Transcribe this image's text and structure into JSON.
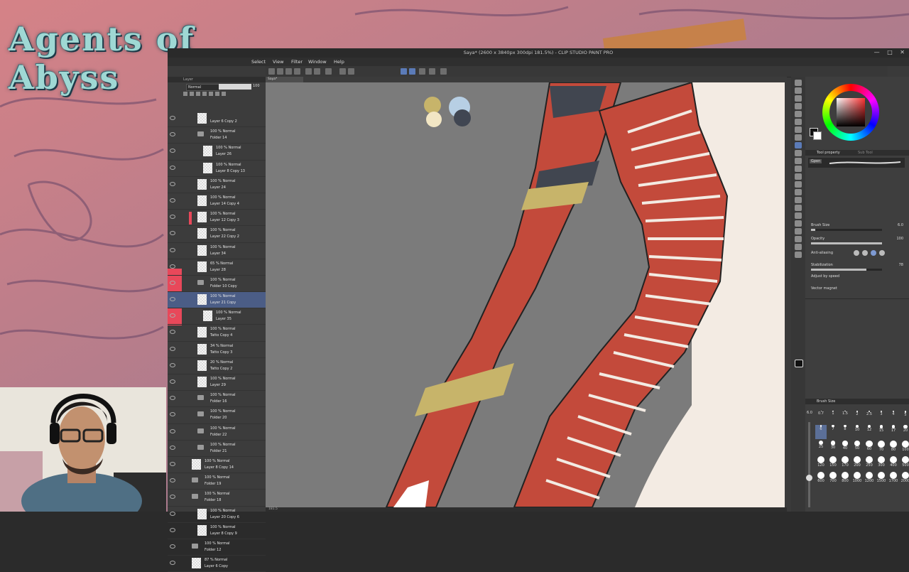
{
  "overlay": {
    "logo_text": "Agents of Abyss"
  },
  "window": {
    "title": "Saya* (2600 x 3840px 300dpi 181.5%) - CLIP STUDIO PAINT PRO",
    "controls": [
      "—",
      "□",
      "✕"
    ]
  },
  "menu": [
    "Select",
    "View",
    "Filter",
    "Window",
    "Help"
  ],
  "layer_panel": {
    "tab": "Layer",
    "blend_mode": "Normal",
    "opacity": "100",
    "layers": [
      {
        "top": "",
        "bottom": "Layer 6 Copy 2",
        "type": "layer",
        "indent": 1
      },
      {
        "top": "100 % Normal",
        "bottom": "Folder 14",
        "type": "folder",
        "indent": 1
      },
      {
        "top": "100 % Normal",
        "bottom": "Layer 26",
        "type": "layer",
        "indent": 2
      },
      {
        "top": "100 % Normal",
        "bottom": "Layer 8 Copy 13",
        "type": "layer",
        "indent": 2
      },
      {
        "top": "100 % Normal",
        "bottom": "Layer 24",
        "type": "layer",
        "indent": 1
      },
      {
        "top": "100 % Normal",
        "bottom": "Layer 14 Copy 4",
        "type": "layer",
        "indent": 1
      },
      {
        "top": "100 % Normal",
        "bottom": "Layer 12 Copy 3",
        "type": "layer",
        "indent": 1
      },
      {
        "top": "100 % Normal",
        "bottom": "Layer 22 Copy 2",
        "type": "layer",
        "indent": 1
      },
      {
        "top": "100 % Normal",
        "bottom": "Layer 34",
        "type": "layer",
        "indent": 1
      },
      {
        "top": "65 % Normal",
        "bottom": "Layer 28",
        "type": "layer",
        "indent": 1
      },
      {
        "top": "100 % Normal",
        "bottom": "Folder 10 Copy",
        "type": "folder",
        "indent": 1
      },
      {
        "top": "100 % Normal",
        "bottom": "Layer 21 Copy",
        "type": "layer",
        "indent": 1,
        "selected": true
      },
      {
        "top": "100 % Normal",
        "bottom": "Layer 35",
        "type": "layer",
        "indent": 2
      },
      {
        "top": "100 % Normal",
        "bottom": "Tatto Copy 4",
        "type": "layer",
        "indent": 1
      },
      {
        "top": "34 % Normal",
        "bottom": "Tatto Copy 3",
        "type": "layer",
        "indent": 1
      },
      {
        "top": "20 % Normal",
        "bottom": "Tatto Copy 2",
        "type": "layer",
        "indent": 1
      },
      {
        "top": "100 % Normal",
        "bottom": "Layer 29",
        "type": "layer",
        "indent": 1
      },
      {
        "top": "100 % Normal",
        "bottom": "Folder 16",
        "type": "folder",
        "indent": 1
      },
      {
        "top": "100 % Normal",
        "bottom": "Folder 20",
        "type": "folder",
        "indent": 1
      },
      {
        "top": "100 % Normal",
        "bottom": "Folder 22",
        "type": "folder",
        "indent": 1
      },
      {
        "top": "100 % Normal",
        "bottom": "Folder 21",
        "type": "folder",
        "indent": 1
      },
      {
        "top": "100 % Normal",
        "bottom": "Layer 8 Copy 14",
        "type": "layer",
        "indent": 0
      },
      {
        "top": "100 % Normal",
        "bottom": "Folder 19",
        "type": "folder",
        "indent": 0
      },
      {
        "top": "100 % Normal",
        "bottom": "Folder 18",
        "type": "folder",
        "indent": 0
      },
      {
        "top": "100 % Normal",
        "bottom": "Layer 20 Copy 6",
        "type": "layer",
        "indent": 1
      },
      {
        "top": "100 % Normal",
        "bottom": "Layer 8 Copy 9",
        "type": "layer",
        "indent": 1
      },
      {
        "top": "100 % Normal",
        "bottom": "Folder 12",
        "type": "folder",
        "indent": 0
      },
      {
        "top": "87 % Normal",
        "bottom": "Layer 6 Copy",
        "type": "layer",
        "indent": 0
      }
    ]
  },
  "canvas": {
    "tab": "Saya*",
    "status": "181.5"
  },
  "tool_property": {
    "tab": "Tool property",
    "tab2": "Sub Tool",
    "brush_name": "Gpen",
    "properties": [
      {
        "label": "Brush Size",
        "value": "6.0",
        "level": 0.06
      },
      {
        "label": "Opacity",
        "value": "100",
        "level": 1.0
      },
      {
        "label": "Anti-aliasing",
        "value": "",
        "level": null
      },
      {
        "label": "Stabilization",
        "value": "78",
        "level": 0.78
      },
      {
        "label": "Adjust by speed",
        "value": "",
        "level": null
      },
      {
        "label": "Vector magnet",
        "value": "",
        "level": null
      }
    ]
  },
  "brush_size_panel": {
    "tab": "Brush Size",
    "current": "6.0",
    "sizes": [
      "0.7",
      "1",
      "1.5",
      "2",
      "2.5",
      "3",
      "4",
      "5",
      "6",
      "7",
      "8",
      "10",
      "12",
      "15",
      "17",
      "20",
      "25",
      "30",
      "40",
      "50",
      "60",
      "70",
      "80",
      "100",
      "120",
      "150",
      "170",
      "200",
      "250",
      "300",
      "400",
      "500",
      "600",
      "700",
      "800",
      "1000",
      "1200",
      "1500",
      "1700",
      "2000"
    ]
  },
  "colors": {
    "accent": "#4b5d86",
    "skin_red": "#c0443a",
    "canvas_bg": "#7a7a7a"
  }
}
